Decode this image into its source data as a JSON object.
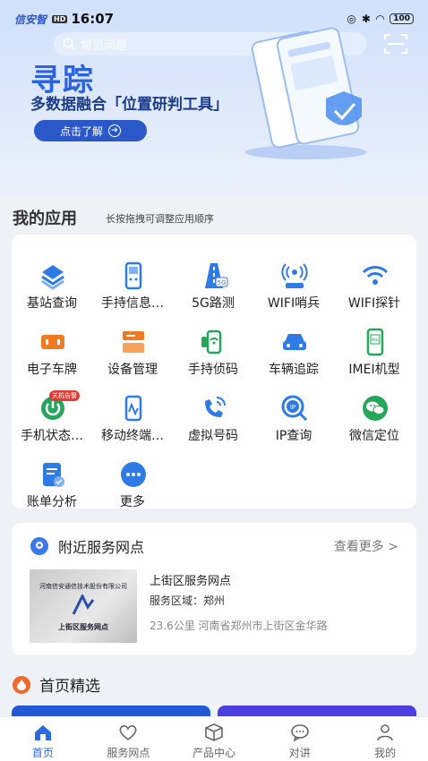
{
  "status": {
    "time": "16:07",
    "battery": "100",
    "logo": "信安智"
  },
  "search": {
    "placeholder": "常见问题"
  },
  "banner": {
    "title": "寻踪",
    "subtitle": "多数据融合「位置研判工具」",
    "cta": "点击了解"
  },
  "apps_section": {
    "title": "我的应用",
    "hint": "长按拖拽可调整应用顺序"
  },
  "apps": [
    {
      "label": "基站查询",
      "icon": "tower-stack-icon",
      "color": "#2f7be6"
    },
    {
      "label": "手持信息…",
      "icon": "handheld-icon",
      "color": "#2f7be6"
    },
    {
      "label": "5G路测",
      "icon": "road-5g-icon",
      "color": "#2f7be6"
    },
    {
      "label": "WIFI哨兵",
      "icon": "wifi-sentinel-icon",
      "color": "#2f7be6"
    },
    {
      "label": "WIFI探针",
      "icon": "wifi-icon",
      "color": "#2f7be6"
    },
    {
      "label": "电子车牌",
      "icon": "plate-icon",
      "color": "#f07a22"
    },
    {
      "label": "设备管理",
      "icon": "device-manage-icon",
      "color": "#f07a22"
    },
    {
      "label": "手持侦码",
      "icon": "phone-detect-icon",
      "color": "#26a65b"
    },
    {
      "label": "车辆追踪",
      "icon": "car-icon",
      "color": "#2f7be6"
    },
    {
      "label": "IMEI机型",
      "icon": "imei-icon",
      "color": "#26a65b"
    },
    {
      "label": "手机状态…",
      "icon": "phone-status-icon",
      "color": "#26a65b",
      "badge": "关机告警"
    },
    {
      "label": "移动终端…",
      "icon": "mobile-terminal-icon",
      "color": "#2f7be6"
    },
    {
      "label": "虚拟号码",
      "icon": "virtual-call-icon",
      "color": "#2f7be6"
    },
    {
      "label": "IP查询",
      "icon": "ip-search-icon",
      "color": "#2f7be6"
    },
    {
      "label": "微信定位",
      "icon": "wechat-icon",
      "color": "#26a65b"
    },
    {
      "label": "账单分析",
      "icon": "bill-icon",
      "color": "#2f7be6"
    },
    {
      "label": "更多",
      "icon": "more-icon",
      "color": "#2f7be6"
    }
  ],
  "nearby": {
    "title": "附近服务网点",
    "more": "查看更多 >",
    "image_caption": "上街区服务网点",
    "image_arc_text": "河南信安通信技术股份有限公司",
    "name": "上街区服务网点",
    "area": "服务区域：郑州",
    "distance": "23.6公里 河南省郑州市上街区金华路"
  },
  "featured": {
    "title": "首页精选"
  },
  "tabs": [
    {
      "label": "首页",
      "icon": "home-icon",
      "active": true
    },
    {
      "label": "服务网点",
      "icon": "heart-icon",
      "active": false
    },
    {
      "label": "产品中心",
      "icon": "box-icon",
      "active": false
    },
    {
      "label": "对讲",
      "icon": "chat-icon",
      "active": false
    },
    {
      "label": "我的",
      "icon": "user-icon",
      "active": false
    }
  ],
  "colors": {
    "accent": "#2a6ae0",
    "banner_title": "#2c64e0",
    "cta": "#2b58c8"
  }
}
